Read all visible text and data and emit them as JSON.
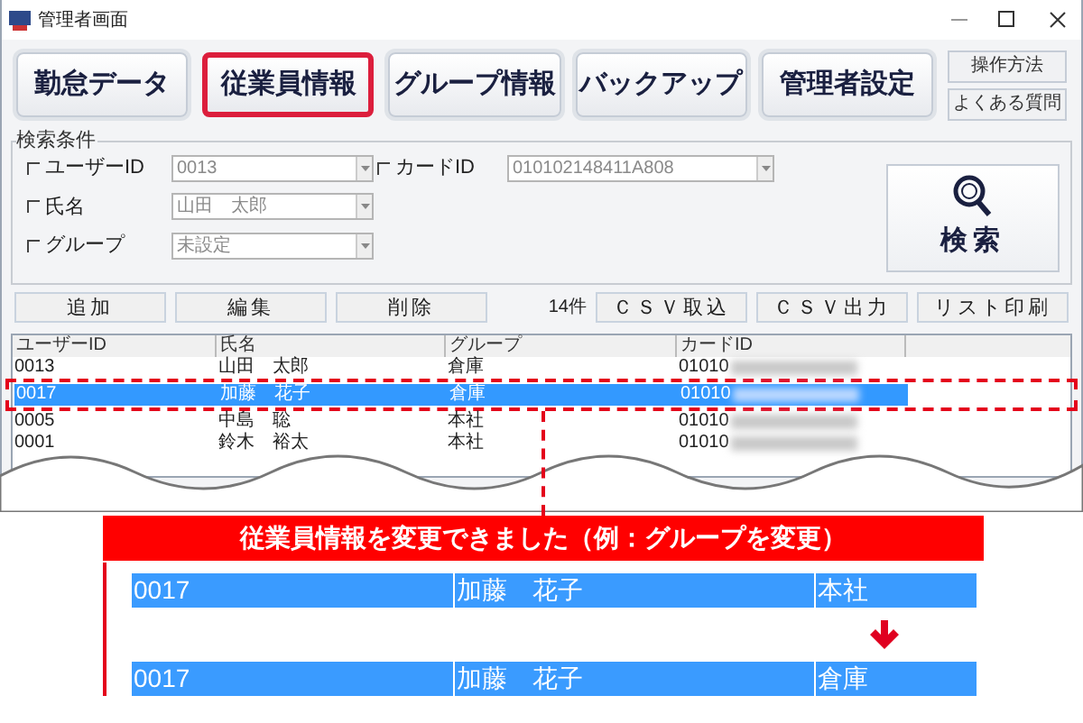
{
  "window": {
    "title": "管理者画面"
  },
  "nav_tabs": [
    {
      "label": "勤怠データ",
      "selected": false
    },
    {
      "label": "従業員情報",
      "selected": true
    },
    {
      "label": "グループ情報",
      "selected": false
    },
    {
      "label": "バックアップ",
      "selected": false
    },
    {
      "label": "管理者設定",
      "selected": false
    }
  ],
  "side_buttons": [
    "操作方法",
    "よくある質問"
  ],
  "search": {
    "title": "検索条件",
    "fields": [
      {
        "label": "ユーザーID",
        "checked": false,
        "value": "0013"
      },
      {
        "label": "カードID",
        "checked": false,
        "value": "010102148411A808"
      },
      {
        "label": "氏名",
        "checked": false,
        "value": "山田　太郎"
      },
      {
        "label": "グループ",
        "checked": false,
        "value": "未設定"
      }
    ],
    "button": "検索"
  },
  "actions": [
    "追加",
    "編集",
    "削除"
  ],
  "count": "14件",
  "export_buttons": [
    "ＣＳＶ取込",
    "ＣＳＶ出力",
    "リスト印刷"
  ],
  "table": {
    "columns": [
      "ユーザーID",
      "氏名",
      "グループ",
      "カードID"
    ],
    "rows": [
      {
        "cells": [
          "0013",
          "山田　太郎",
          "倉庫",
          "01010"
        ],
        "selected": false
      },
      {
        "cells": [
          "0017",
          "加藤　花子",
          "倉庫",
          "01010"
        ],
        "selected": true
      },
      {
        "cells": [
          "0005",
          "中島　聡",
          "本社",
          "01010"
        ],
        "selected": false
      },
      {
        "cells": [
          "0001",
          "鈴木　裕太",
          "本社",
          "01010"
        ],
        "selected": false
      }
    ]
  },
  "callout": {
    "message": "従業員情報を変更できました（例：グループを変更）",
    "before": [
      "0017",
      "加藤　花子",
      "本社"
    ],
    "after": [
      "0017",
      "加藤　花子",
      "倉庫"
    ]
  }
}
